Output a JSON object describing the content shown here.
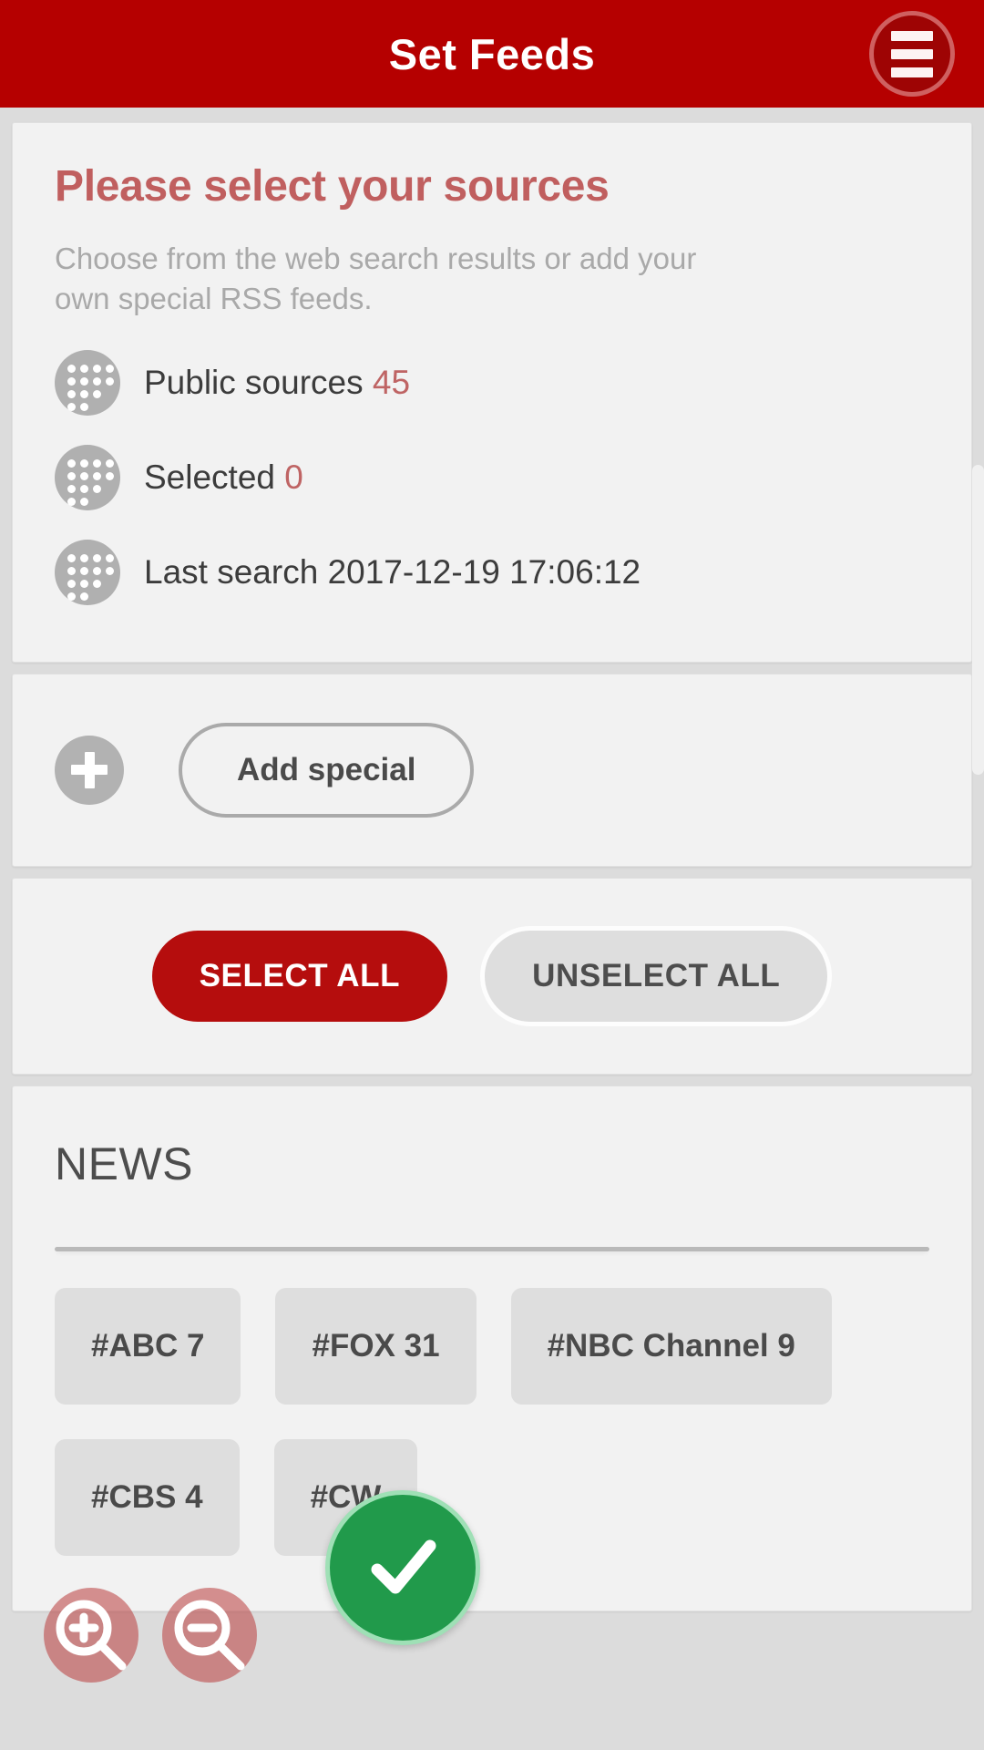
{
  "appbar": {
    "title": "Set Feeds",
    "menu_icon": "hamburger-menu-icon"
  },
  "sources_card": {
    "headline": "Please select your sources",
    "subtext": "Choose from the web search results or add your own special RSS feeds.",
    "rows": [
      {
        "label": "Public sources",
        "value": "45",
        "icon": "dot-grid-icon"
      },
      {
        "label": "Selected",
        "value": "0",
        "icon": "dot-grid-icon"
      },
      {
        "label": "Last search",
        "value": "2017-12-19 17:06:12",
        "icon": "dot-grid-icon"
      }
    ]
  },
  "add_card": {
    "plus_icon": "plus-icon",
    "button_label": "Add special"
  },
  "select_card": {
    "select_all_label": "SELECT ALL",
    "unselect_all_label": "UNSELECT ALL"
  },
  "news_card": {
    "title": "NEWS",
    "chips": [
      "#ABC 7",
      "#FOX 31",
      "#NBC Channel 9",
      "#CBS 4",
      "#CW"
    ]
  },
  "overlay": {
    "zoom_in_icon": "zoom-in-magnifier-icon",
    "zoom_out_icon": "zoom-out-magnifier-icon",
    "confirm_icon": "checkmark-icon"
  },
  "colors": {
    "appbar_red": "#b50000",
    "headline_rose": "#c05f5f",
    "primary_red": "#b50d0d",
    "confirm_green": "#219a4b",
    "accent_number": "#bf6464"
  }
}
